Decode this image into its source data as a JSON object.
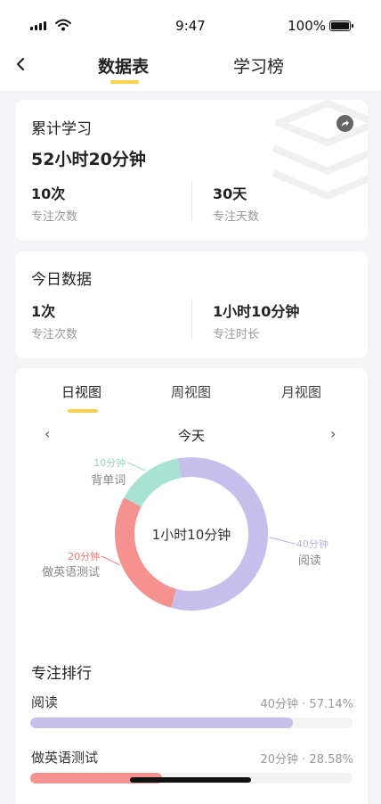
{
  "status_bar": {
    "time": "9:47",
    "battery": "100%"
  },
  "nav": {
    "tabs": [
      {
        "label": "数据表"
      },
      {
        "label": "学习榜"
      }
    ]
  },
  "total": {
    "title": "累计学习",
    "duration": "52小时20分钟",
    "stats": [
      {
        "value": "10次",
        "label": "专注次数"
      },
      {
        "value": "30天",
        "label": "专注天数"
      }
    ]
  },
  "today": {
    "title": "今日数据",
    "stats": [
      {
        "value": "1次",
        "label": "专注次数"
      },
      {
        "value": "1小时10分钟",
        "label": "专注时长"
      }
    ]
  },
  "chart": {
    "view_tabs": [
      {
        "label": "日视图"
      },
      {
        "label": "周视图"
      },
      {
        "label": "月视图"
      }
    ],
    "date_label": "今天",
    "prev_glyph": "‹",
    "next_glyph": "›"
  },
  "chart_data": {
    "type": "pie",
    "center_label": "1小时10分钟",
    "slices": [
      {
        "name": "阅读",
        "value_label": "40分钟",
        "minutes": 40,
        "color": "#c6bfeb",
        "label_color": "#b9b0e6"
      },
      {
        "name": "做英语测试",
        "value_label": "20分钟",
        "minutes": 20,
        "color": "#f5918f",
        "label_color": "#f07c78"
      },
      {
        "name": "背单词",
        "value_label": "10分钟",
        "minutes": 10,
        "color": "#a8e2d2",
        "label_color": "#8ed8c4"
      }
    ]
  },
  "ranking": {
    "title": "专注排行",
    "items": [
      {
        "name": "阅读",
        "meta": "40分钟 · 57.14%",
        "percent": 57.14,
        "color": "#c6bfeb"
      },
      {
        "name": "做英语测试",
        "meta": "20分钟 · 28.58%",
        "percent": 28.58,
        "color": "#f5918f"
      }
    ]
  }
}
